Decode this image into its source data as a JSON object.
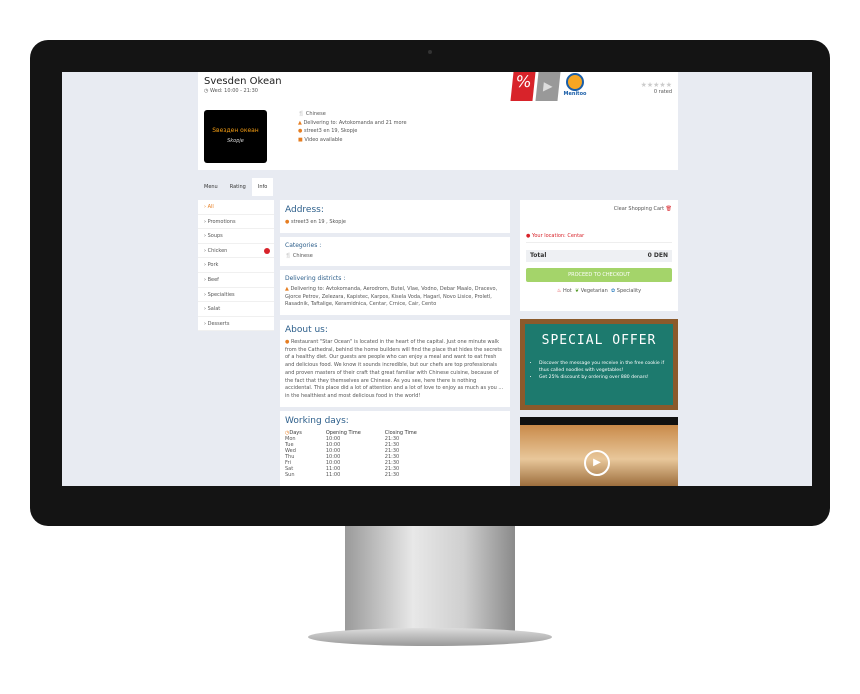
{
  "restaurant": {
    "name": "Svesden Okean",
    "hours": "Wed: 10:00 - 21:30",
    "rated": "0 rated",
    "category": "Chinese",
    "delivering": "Delivering to: Avtokomanda and 21 more",
    "address": "street3 en 19, Skopje",
    "video": "Video available",
    "logo_text": "Ѕвезден океан",
    "logo_sub": "Skopje"
  },
  "badges": {
    "promo": "%",
    "brand": "Menitoo"
  },
  "tabs": [
    "Menu",
    "Rating",
    "Info"
  ],
  "sidebar": [
    "All",
    "Promotions",
    "Soups",
    "Chicken",
    "Pork",
    "Beef",
    "Specialties",
    "Salat",
    "Desserts"
  ],
  "info": {
    "address_title": "Address:",
    "address": "street3 en 19 , Skopje",
    "categories_title": "Categories :",
    "categories": "Chinese",
    "districts_title": "Delivering districts :",
    "districts": "Delivering to: Avtokomanda, Aerodrom, Butel, Vlae, Vodno, Debar Maalo, Dracevo, Gjorce Petrov, Zelezara, Kapistec, Karpos, Kisela Voda, Hagarl, Novo Lisice, Proletl, Rasadnik, Taftalige, Keramidnica, Centar, Crnice, Cair, Cento",
    "about_title": "About us:",
    "about": "Restaurant \"Star Ocean\" is located in the heart of the capital. Just one minute walk from the Cathedral, behind the home builders will find the place that hides the secrets of a healthy diet. Our guests are people who can enjoy a meal and want to eat fresh and delicious food. We know it sounds incredible, but our chefs are top professionals and proven masters of their craft that great familiar with Chinese cuisine, because of the fact that they themselves are Chinese. As you see, here there is nothing accidental. This place did a lot of attention and a lot of love to enjoy as much as you ... in the healthiest and most delicious food in the world!",
    "working_title": "Working days:",
    "columns": [
      "Days",
      "Opening Time",
      "Closing Time"
    ],
    "days": [
      [
        "Mon",
        "10:00",
        "21:30"
      ],
      [
        "Tue",
        "10:00",
        "21:30"
      ],
      [
        "Wed",
        "10:00",
        "21:30"
      ],
      [
        "Thu",
        "10:00",
        "21:30"
      ],
      [
        "Fri",
        "10:00",
        "21:30"
      ],
      [
        "Sat",
        "11:00",
        "21:30"
      ],
      [
        "Sun",
        "11:00",
        "21:30"
      ]
    ]
  },
  "cart": {
    "clear": "Clear Shopping Cart",
    "location": "Your location: Centar",
    "total_label": "Total",
    "total": "0 DEN",
    "checkout": "PROCEED TO CHECKOUT",
    "legend": [
      "Hot",
      "Vegetarian",
      "Speciality"
    ]
  },
  "offer": {
    "title": "SPECIAL OFFER",
    "items": [
      "Discover the message you receive in the free cookie if thus called noodles with vegetables!",
      "Get 25% discount by ordering over 880 denars!"
    ]
  }
}
